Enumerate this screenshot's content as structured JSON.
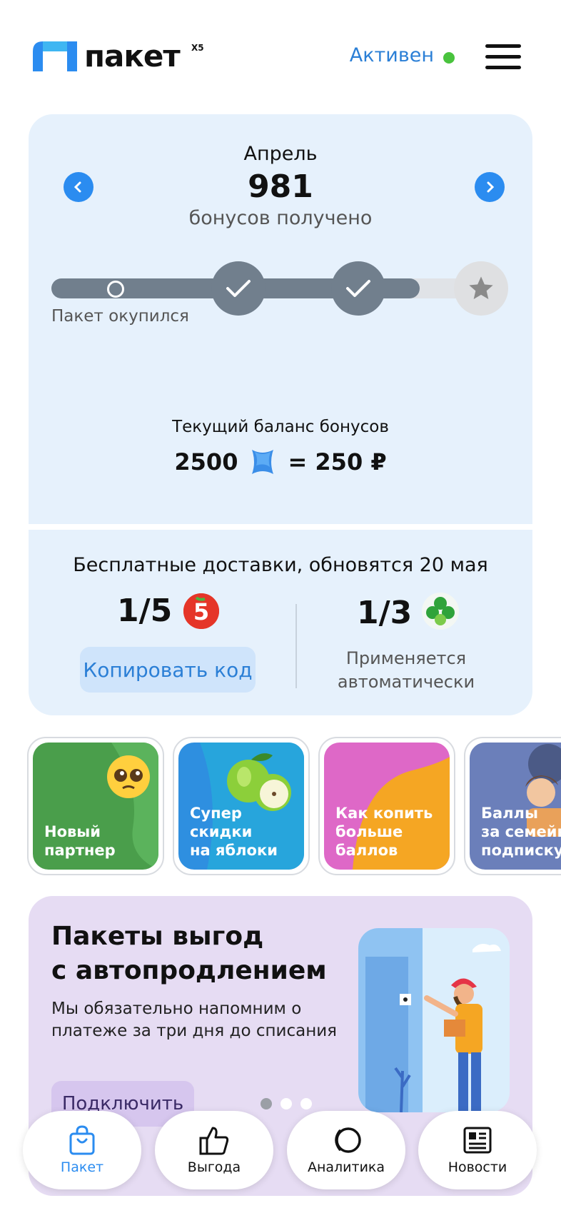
{
  "header": {
    "logo_text": "пакет",
    "logo_badge": "X5",
    "status": "Активен"
  },
  "summary": {
    "month": "Апрель",
    "bonus_count": "981",
    "bonus_caption": "бонусов  получено",
    "progress_label": "Пакет окупился",
    "balance_label": "Текущий баланс бонусов",
    "balance_points": "2500",
    "balance_rub": "= 250 ₽"
  },
  "deliveries": {
    "title": "Бесплатные доставки, обновятся 20 мая",
    "pyaterochka": "1/5",
    "perekrestok": "1/3",
    "copy_button": "Копировать код",
    "auto_note_line1": "Применяется",
    "auto_note_line2": "автоматически"
  },
  "stories": [
    {
      "line1": "Новый",
      "line2": "партнер",
      "line3": ""
    },
    {
      "line1": "Супер",
      "line2": "скидки",
      "line3": "на яблоки"
    },
    {
      "line1": "Как копить",
      "line2": "больше",
      "line3": "баллов"
    },
    {
      "line1": "Баллы",
      "line2": "за семейн",
      "line3": "подписку"
    }
  ],
  "promo": {
    "title_line1": "Пакеты выгод",
    "title_line2": "с автопродлением",
    "text_line1": "Мы обязательно напомним о",
    "text_line2": "платеже за три дня до списания",
    "button": "Подключить"
  },
  "tabbar": [
    {
      "label": "Пакет",
      "active": true
    },
    {
      "label": "Выгода",
      "active": false
    },
    {
      "label": "Аналитика",
      "active": false
    },
    {
      "label": "Новости",
      "active": false
    }
  ],
  "colors": {
    "accent": "#2B8CF0",
    "status_green": "#49C33D",
    "card_bg": "#E6F1FC",
    "promo_bg": "#E6DCF3",
    "progress": "#717F8D"
  }
}
